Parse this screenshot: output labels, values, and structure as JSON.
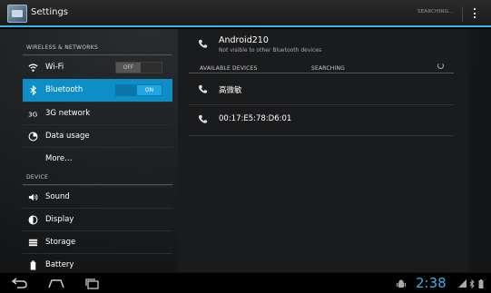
{
  "app": {
    "title": "Settings",
    "searching_button": "SEARCHING..."
  },
  "sections": {
    "wireless": "WIRELESS & NETWORKS",
    "device": "DEVICE"
  },
  "left_items": [
    {
      "label": "Wi-Fi",
      "icon": "wifi-icon",
      "toggle": "OFF"
    },
    {
      "label": "Bluetooth",
      "icon": "bluetooth-icon",
      "toggle": "ON",
      "selected": true
    },
    {
      "label": "3G network",
      "icon": "network-icon"
    },
    {
      "label": "Data usage",
      "icon": "data-usage-icon"
    },
    {
      "label": "More…"
    },
    {
      "label": "Sound",
      "icon": "speaker-icon"
    },
    {
      "label": "Display",
      "icon": "display-icon"
    },
    {
      "label": "Storage",
      "icon": "storage-icon"
    },
    {
      "label": "Battery",
      "icon": "battery-icon"
    }
  ],
  "bluetooth": {
    "device_name": "Android210",
    "device_status": "Not visible to other Bluetooth devices",
    "available_header": "AVAILABLE DEVICES",
    "searching_header": "SEARCHING",
    "devices": [
      {
        "name": "高微敏"
      },
      {
        "name": "00:17:E5:78:D6:01"
      }
    ]
  },
  "statusbar": {
    "clock": "2:38"
  },
  "colors": {
    "accent": "#33b5e5",
    "selected": "#0d8ec6"
  }
}
